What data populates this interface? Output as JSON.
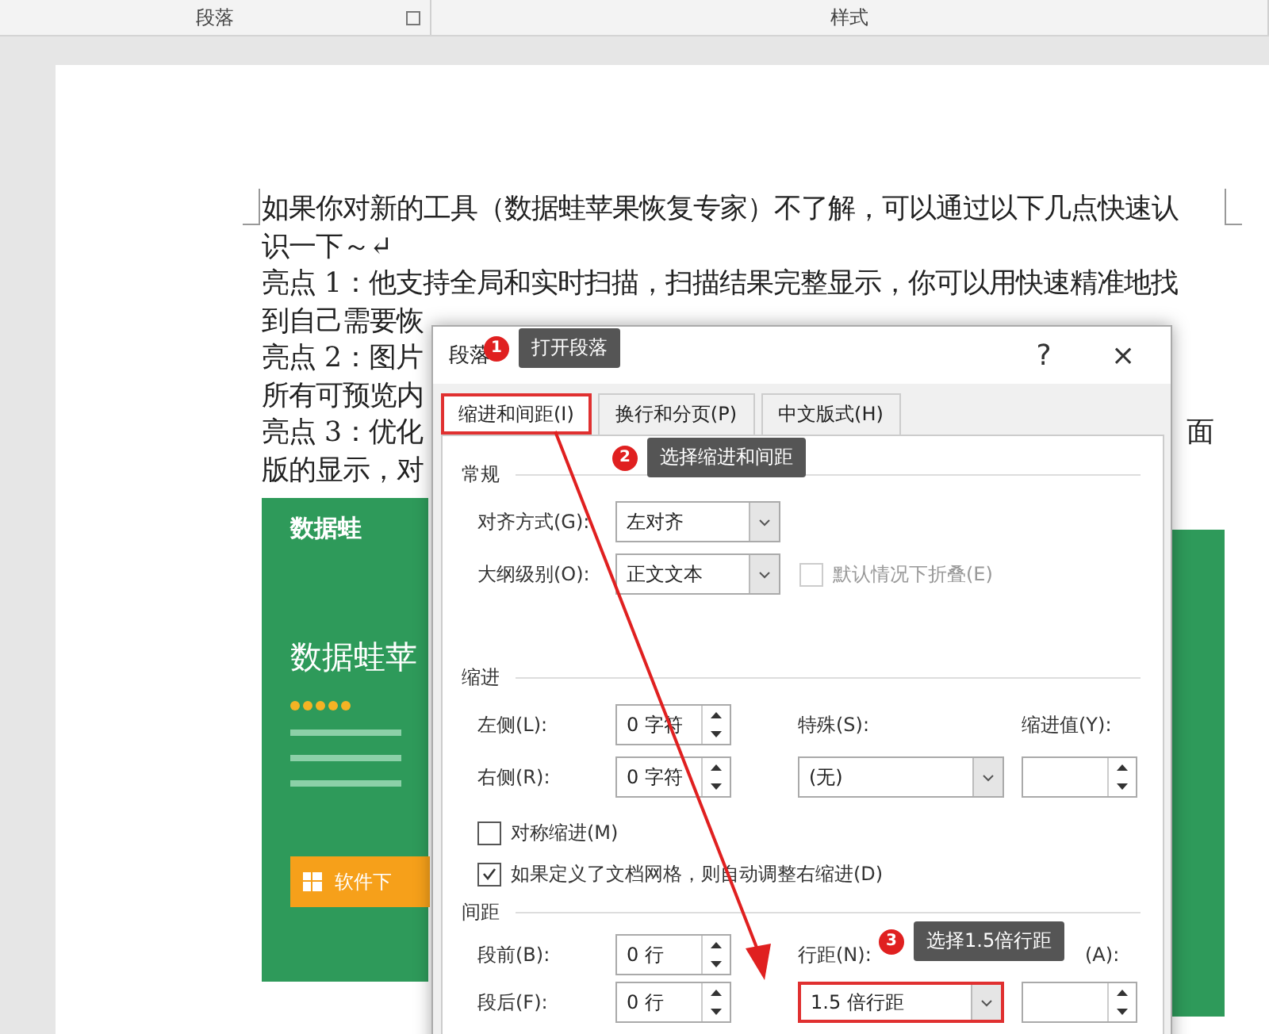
{
  "ribbon": {
    "groups": [
      {
        "label": "段落",
        "launcher": true
      },
      {
        "label": "样式",
        "launcher": false
      }
    ]
  },
  "document": {
    "lines": [
      {
        "text": "如果你对新的工具（数据蛙苹果恢复专家）不了解，可以通过以下几点快速认"
      },
      {
        "text": "识一下～↵"
      },
      {
        "text": "亮点 1：他支持全局和实时扫描，扫描结果完整显示，你可以用快速精准地找"
      },
      {
        "text": "到自己需要恢"
      },
      {
        "text": "亮点 2：图片"
      },
      {
        "text": "所有可预览内"
      },
      {
        "text": "亮点 3：优化",
        "tail": "面"
      },
      {
        "text": "版的显示，对"
      }
    ]
  },
  "promo": {
    "brand": "数据蛙",
    "headline": "数据蛙苹",
    "stars": 5,
    "button": "软件下"
  },
  "dialog": {
    "title": "段落",
    "help": "?",
    "close": "×",
    "tabs": [
      {
        "label": "缩进和间距(I)",
        "selected": true
      },
      {
        "label": "换行和分页(P)",
        "selected": false
      },
      {
        "label": "中文版式(H)",
        "selected": false
      }
    ],
    "general": {
      "title": "常规",
      "alignment": {
        "label": "对齐方式(G):",
        "value": "左对齐"
      },
      "outline": {
        "label": "大纲级别(O):",
        "value": "正文文本"
      },
      "collapse": {
        "label": "默认情况下折叠(E)",
        "checked": false,
        "disabled": true
      }
    },
    "indent": {
      "title": "缩进",
      "left": {
        "label": "左侧(L):",
        "value": "0 字符"
      },
      "right": {
        "label": "右侧(R):",
        "value": "0 字符"
      },
      "special": {
        "label": "特殊(S):",
        "value": "(无)"
      },
      "by": {
        "label": "缩进值(Y):"
      },
      "mirror": {
        "label": "对称缩进(M)",
        "checked": false,
        "disabled": false
      },
      "auto": {
        "label": "如果定义了文档网格，则自动调整右缩进(D)",
        "checked": true,
        "disabled": false
      }
    },
    "spacing": {
      "title": "间距",
      "before": {
        "label": "段前(B):",
        "value": "0 行"
      },
      "after": {
        "label": "段后(F):",
        "value": "0 行"
      },
      "line": {
        "label": "行距(N):",
        "value": "1.5 倍行距"
      },
      "at": {
        "label": "(A):"
      }
    }
  },
  "annotations": [
    {
      "number": "1",
      "text": "打开段落"
    },
    {
      "number": "2",
      "text": "选择缩进和间距"
    },
    {
      "number": "3",
      "text": "选择1.5倍行距"
    }
  ]
}
